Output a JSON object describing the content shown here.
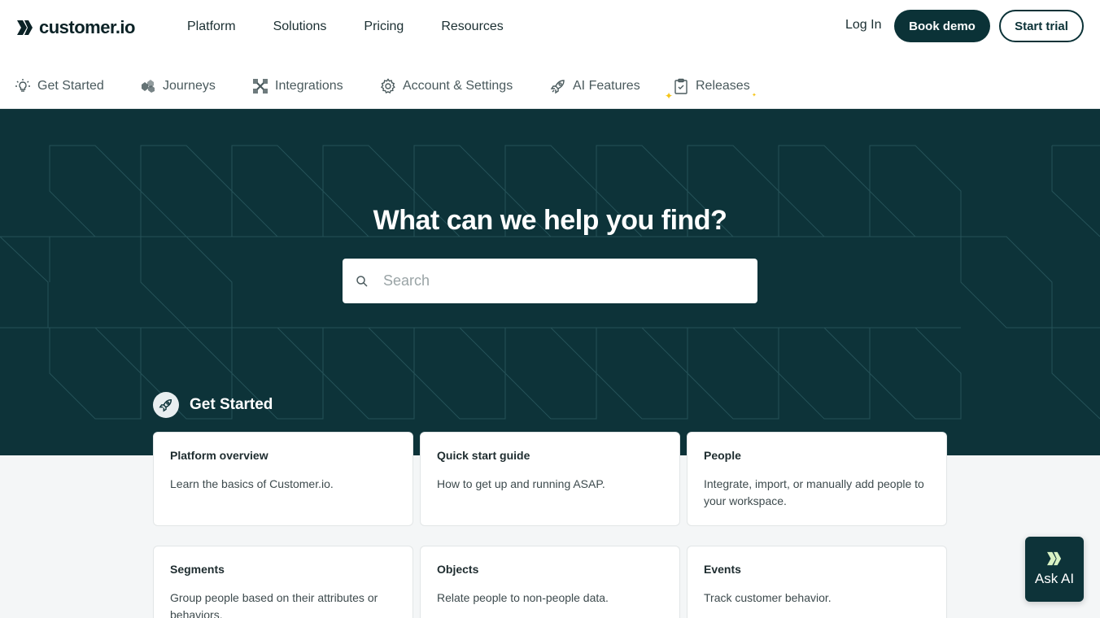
{
  "brand": {
    "name": "customer.io"
  },
  "nav": {
    "links": [
      "Platform",
      "Solutions",
      "Pricing",
      "Resources"
    ],
    "login": "Log In",
    "book_demo": "Book demo",
    "start_trial": "Start trial"
  },
  "subnav": {
    "items": [
      {
        "label": "Get Started",
        "icon": "lightbulb-icon"
      },
      {
        "label": "Journeys",
        "icon": "journeys-icon"
      },
      {
        "label": "Integrations",
        "icon": "integrations-icon"
      },
      {
        "label": "Account & Settings",
        "icon": "gear-icon"
      },
      {
        "label": "AI Features",
        "icon": "rocket-icon"
      },
      {
        "label": "Releases",
        "icon": "clipboard-check-icon"
      }
    ]
  },
  "hero": {
    "title": "What can we help you find?",
    "search_placeholder": "Search"
  },
  "section": {
    "title": "Get Started",
    "icon": "rocket-icon"
  },
  "cards": [
    {
      "title": "Platform overview",
      "desc": "Learn the basics of Customer.io."
    },
    {
      "title": "Quick start guide",
      "desc": "How to get up and running ASAP."
    },
    {
      "title": "People",
      "desc": "Integrate, import, or manually add people to your workspace."
    },
    {
      "title": "Segments",
      "desc": "Group people based on their attributes or behaviors."
    },
    {
      "title": "Objects",
      "desc": "Relate people to non-people data."
    },
    {
      "title": "Events",
      "desc": "Track customer behavior."
    }
  ],
  "ask_ai": {
    "label": "Ask AI"
  },
  "colors": {
    "primary": "#0d3339",
    "accent": "#f5c518",
    "background": "#f4f6f7"
  }
}
